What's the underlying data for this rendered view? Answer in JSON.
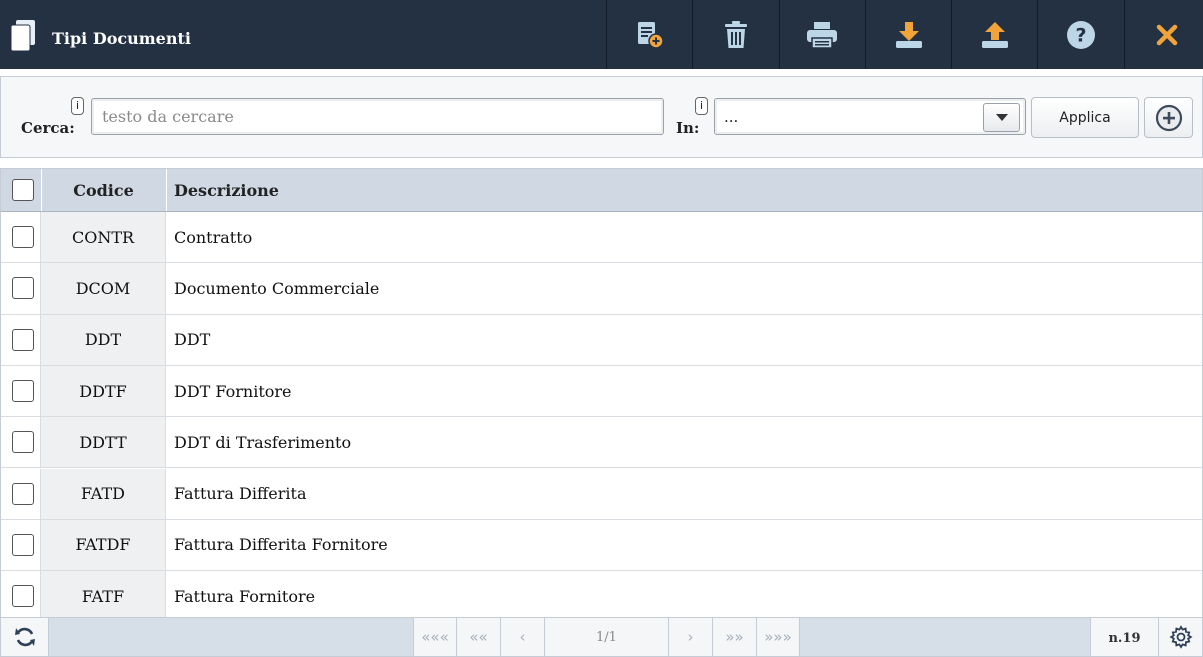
{
  "header": {
    "title": "Tipi Documenti",
    "icon": "documents-icon",
    "toolbar": [
      {
        "name": "new-document-button",
        "icon": "new-document-icon"
      },
      {
        "name": "delete-button",
        "icon": "trash-icon"
      },
      {
        "name": "print-button",
        "icon": "printer-icon"
      },
      {
        "name": "download-button",
        "icon": "download-icon"
      },
      {
        "name": "upload-button",
        "icon": "upload-icon"
      },
      {
        "name": "help-button",
        "icon": "help-icon"
      },
      {
        "name": "close-button",
        "icon": "close-icon"
      }
    ]
  },
  "search": {
    "label": "Cerca:",
    "info": "i",
    "placeholder": "testo da cercare",
    "value": "",
    "in_label": "In:",
    "in_info": "i",
    "in_value": "...",
    "apply_label": "Applica"
  },
  "grid": {
    "columns": {
      "code": "Codice",
      "description": "Descrizione"
    },
    "rows": [
      {
        "code": "CONTR",
        "description": "Contratto"
      },
      {
        "code": "DCOM",
        "description": "Documento Commerciale"
      },
      {
        "code": "DDT",
        "description": "DDT"
      },
      {
        "code": "DDTF",
        "description": "DDT Fornitore"
      },
      {
        "code": "DDTT",
        "description": "DDT di Trasferimento"
      },
      {
        "code": "FATD",
        "description": "Fattura Differita"
      },
      {
        "code": "FATDF",
        "description": "Fattura Differita Fornitore"
      },
      {
        "code": "FATF",
        "description": "Fattura Fornitore"
      }
    ]
  },
  "pager": {
    "first": "«««",
    "prev_fast": "««",
    "prev": "‹",
    "info": "1/1",
    "next": "›",
    "next_fast": "»»",
    "last": "»»»",
    "count": "n.19"
  },
  "colors": {
    "header_bg": "#243143",
    "icon_light": "#bcd6e8",
    "icon_accent": "#f0a43a",
    "grid_header": "#cfd8e3"
  }
}
